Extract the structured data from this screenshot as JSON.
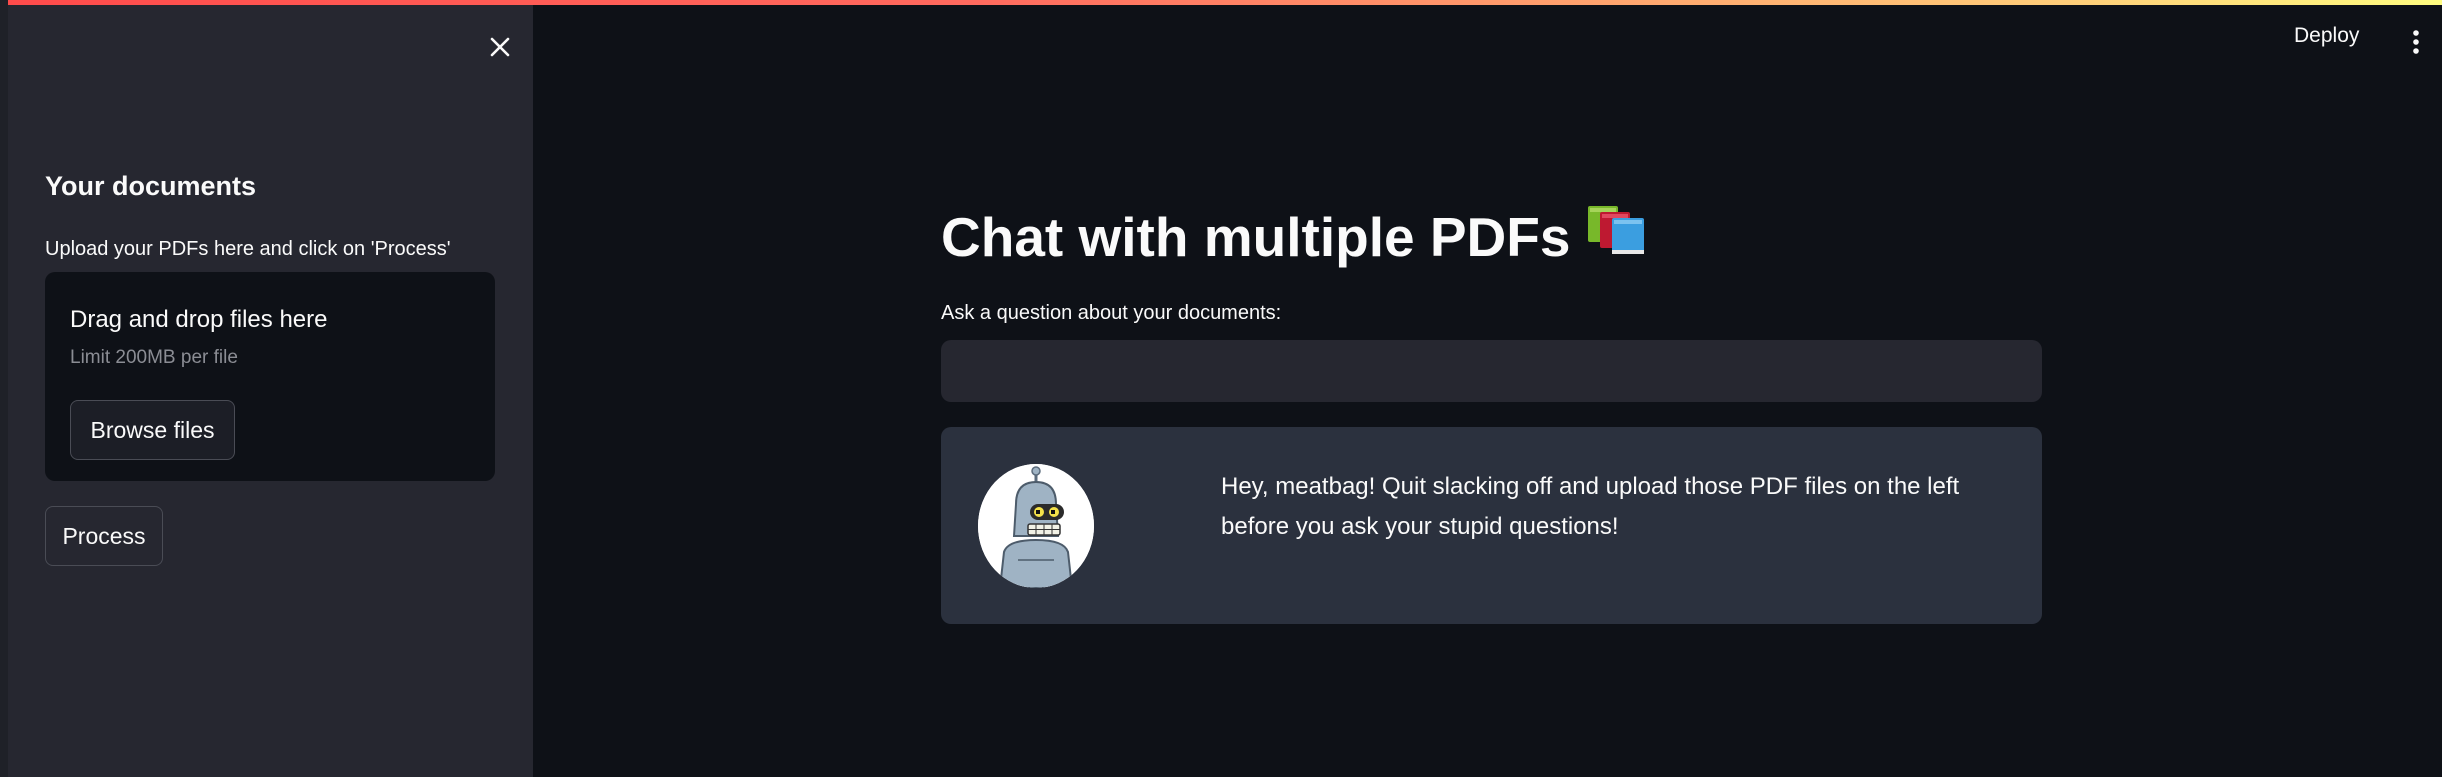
{
  "sidebar": {
    "heading": "Your documents",
    "upload_label": "Upload your PDFs here and click on 'Process'",
    "dropzone": {
      "title": "Drag and drop files here",
      "limit": "Limit 200MB per file",
      "browse_label": "Browse files"
    },
    "process_label": "Process",
    "close_icon": "close-icon"
  },
  "header": {
    "deploy_label": "Deploy",
    "menu_icon": "vertical-dots-icon"
  },
  "main": {
    "title": "Chat with multiple PDFs",
    "title_emoji_icon": "books-icon",
    "question_label": "Ask a question about your documents:",
    "question_value": "",
    "bot_message": "Hey, meatbag! Quit slacking off and upload those PDF files on the left before you ask your stupid questions!",
    "bot_avatar_icon": "robot-avatar"
  },
  "colors": {
    "background": "#0e1117",
    "sidebar": "#262730",
    "card": "#2b313e",
    "accent": "#ff4b4b"
  }
}
